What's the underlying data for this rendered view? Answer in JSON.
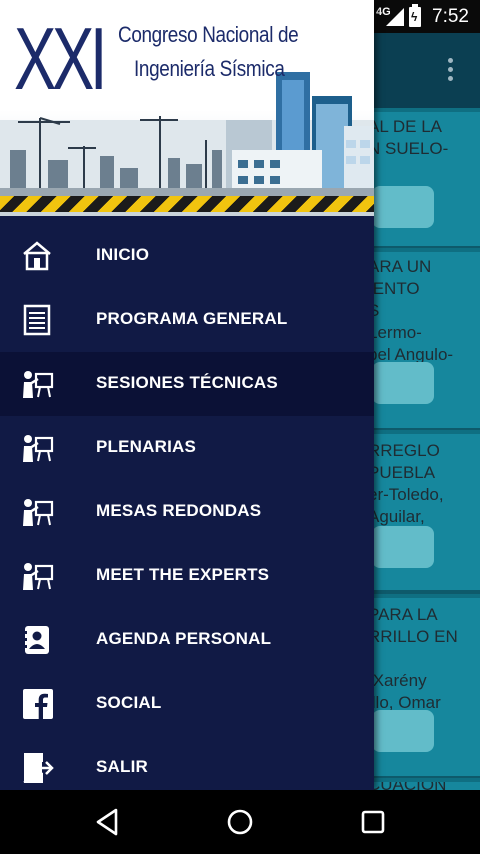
{
  "status_bar": {
    "network_label": "4G",
    "signal_icon": "cell-signal-icon",
    "battery_icon": "battery-charging-icon",
    "time": "7:52"
  },
  "background": {
    "menu_icon": "more-vert-icon",
    "cards": [
      {
        "text": "AL DE LA\nN SUELO-\n\nz Rocha"
      },
      {
        "text": "ARA UN\nIENTO\nS\nLermo-\nbel Angulo-"
      },
      {
        "text": "RREGLO\nPUEBLA\ner-Toledo,\nAguilar,\na"
      },
      {
        "text": "PARA LA\nRRILLO EN\n\n Xarény\nillo, Omar\nodríguez"
      },
      {
        "text": "CUACIÓN"
      }
    ]
  },
  "drawer": {
    "header": {
      "logo_numeral": "XXI",
      "logo_line1": "Congreso Nacional de",
      "logo_line2": "Ingeniería Sísmica"
    },
    "items": [
      {
        "label": "INICIO",
        "icon": "home-icon"
      },
      {
        "label": "PROGRAMA GENERAL",
        "icon": "document-list-icon"
      },
      {
        "label": "SESIONES TÉCNICAS",
        "icon": "presenter-icon",
        "active": true
      },
      {
        "label": "PLENARIAS",
        "icon": "presenter-icon"
      },
      {
        "label": "MESAS REDONDAS",
        "icon": "presenter-icon"
      },
      {
        "label": "MEET THE EXPERTS",
        "icon": "presenter-icon"
      },
      {
        "label": "AGENDA PERSONAL",
        "icon": "contact-book-icon"
      },
      {
        "label": "SOCIAL",
        "icon": "facebook-icon"
      },
      {
        "label": "SALIR",
        "icon": "exit-icon"
      }
    ]
  },
  "nav_bar": {
    "back_icon": "back-triangle-icon",
    "home_icon": "home-circle-icon",
    "recents_icon": "recents-square-icon"
  },
  "colors": {
    "drawer_bg": "#111a45",
    "active_item_bg": "#0b1136",
    "logo_blue": "#1c2b6a",
    "background_card": "#16879d"
  }
}
